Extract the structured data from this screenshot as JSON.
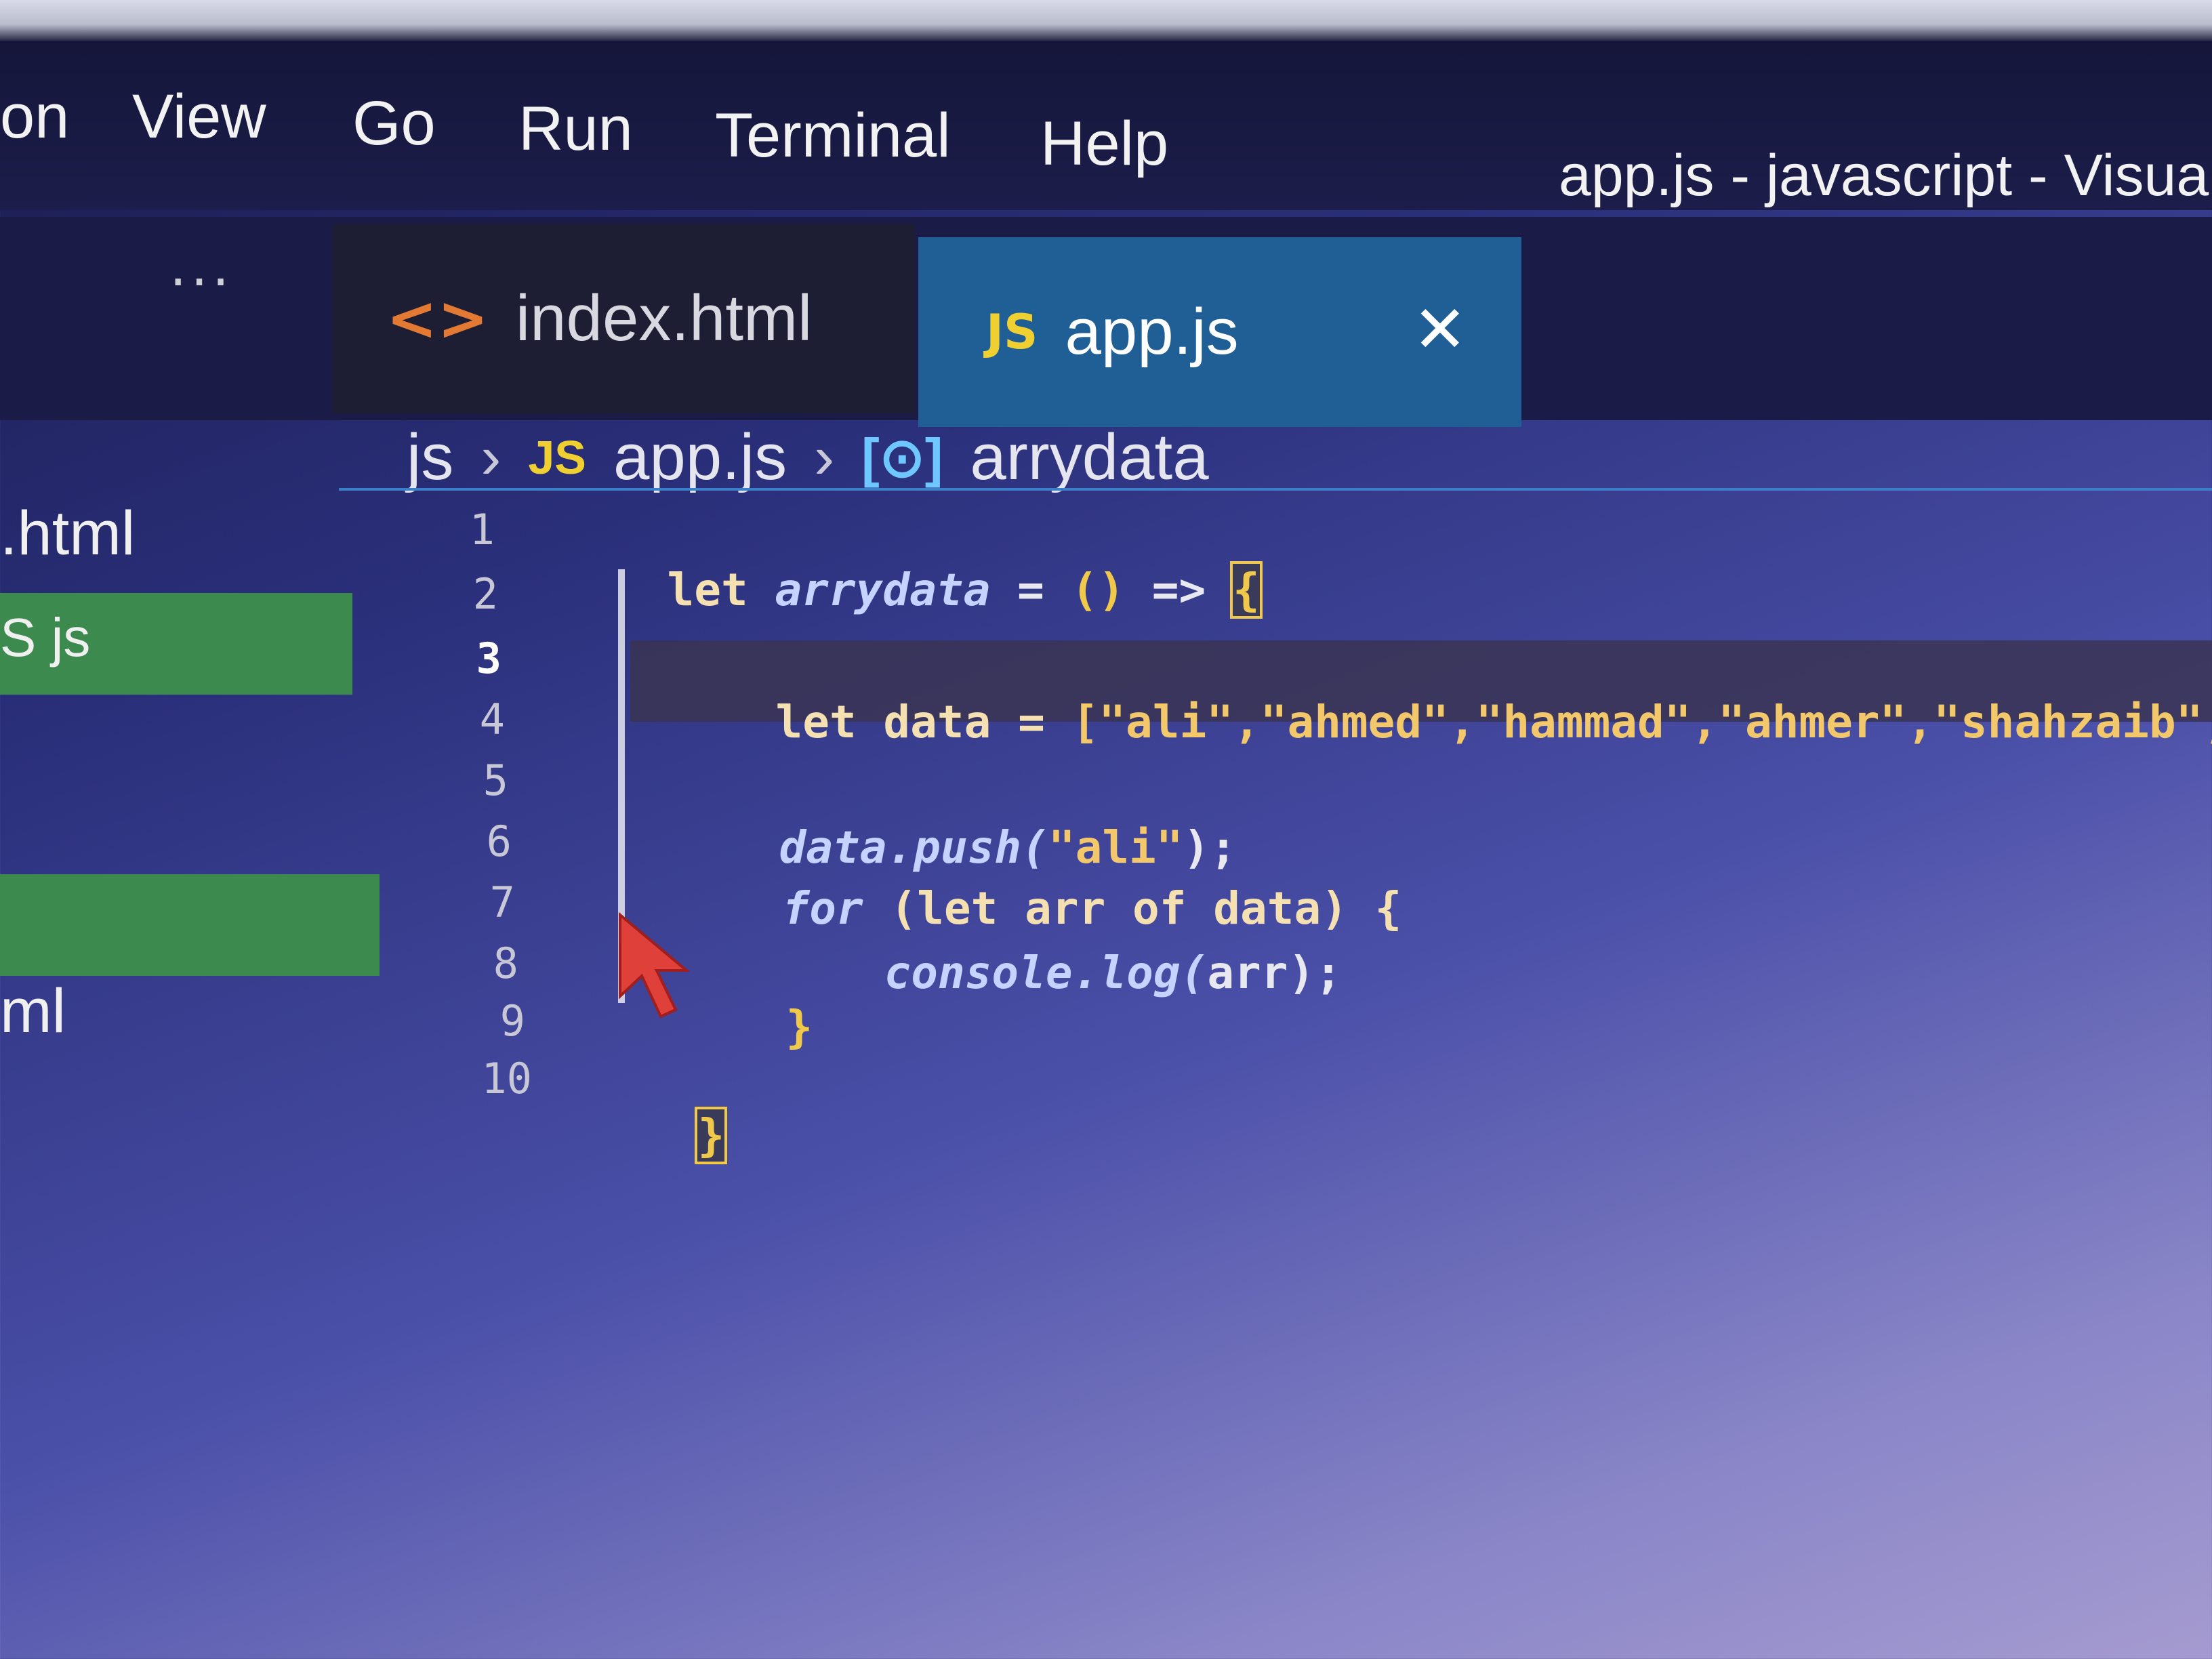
{
  "menu": {
    "items": [
      "on",
      "View",
      "Go",
      "Run",
      "Terminal",
      "Help"
    ]
  },
  "window": {
    "title": "app.js - javascript - Visua"
  },
  "tabs": {
    "ellipsis": "···",
    "index": {
      "label": "index.html",
      "icon": "html-icon"
    },
    "app": {
      "label": "app.js",
      "icon": "js-icon",
      "close": "✕"
    }
  },
  "breadcrumb": {
    "folder": "js",
    "sep": "›",
    "js_badge": "JS",
    "file": "app.js",
    "symbol_icon": "[⊙]",
    "symbol": "arrydata"
  },
  "sidebar": {
    "item1": ".html",
    "item2": "S  js",
    "item3": "ml"
  },
  "editor": {
    "line_numbers": [
      "1",
      "2",
      "3",
      "4",
      "5",
      "6",
      "7",
      "8",
      "9",
      "10"
    ],
    "active_line": 3,
    "lines": {
      "l1_let": "let ",
      "l1_name": "arrydata",
      "l1_eq": " = ",
      "l1_paren": "()",
      "l1_arrow": " => ",
      "l1_brace": "{",
      "l3_let": "let data = ",
      "l3_array": "[\"ali\",\"ahmed\",\"hammad\",\"ahmer\",\"shahzaib\",\"fa",
      "l5_call": "data.push(",
      "l5_arg": "\"ali\"",
      "l5_end": ");",
      "l6_for": "for",
      "l6_rest": " (let arr of data) {",
      "l7_call": "console.log(",
      "l7_arg": "arr",
      "l7_end": ");",
      "l8_close": "}",
      "l10_close": "}"
    }
  },
  "colors": {
    "tab_active": "#1f5f96",
    "sidebar_highlight": "#3d8a4f",
    "js_badge": "#f0d030",
    "html_icon": "#e37933"
  }
}
